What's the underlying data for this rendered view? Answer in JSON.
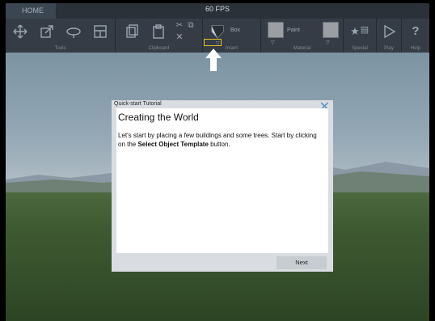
{
  "app": {
    "home_tab": "HOME",
    "fps": "60 FPS"
  },
  "toolbar": {
    "groups": [
      "Tools",
      "Clipboard",
      "Insert",
      "Material",
      "Special",
      "Play",
      "Help"
    ],
    "insert_box_label": "Box",
    "material_paint_label": "Paint",
    "help_glyph": "?"
  },
  "dialog": {
    "title": "Quick-start Tutorial",
    "heading": "Creating the World",
    "text_part1": "Let's start by placing a few buildings and some trees. Start by clicking on the ",
    "text_bold": "Select Object Template",
    "text_part2": " button.",
    "next_label": "Next"
  },
  "colors": {
    "toolbar_bg": "#363c45",
    "highlight": "#e5c021",
    "dialog_bg": "#d9dde1"
  }
}
